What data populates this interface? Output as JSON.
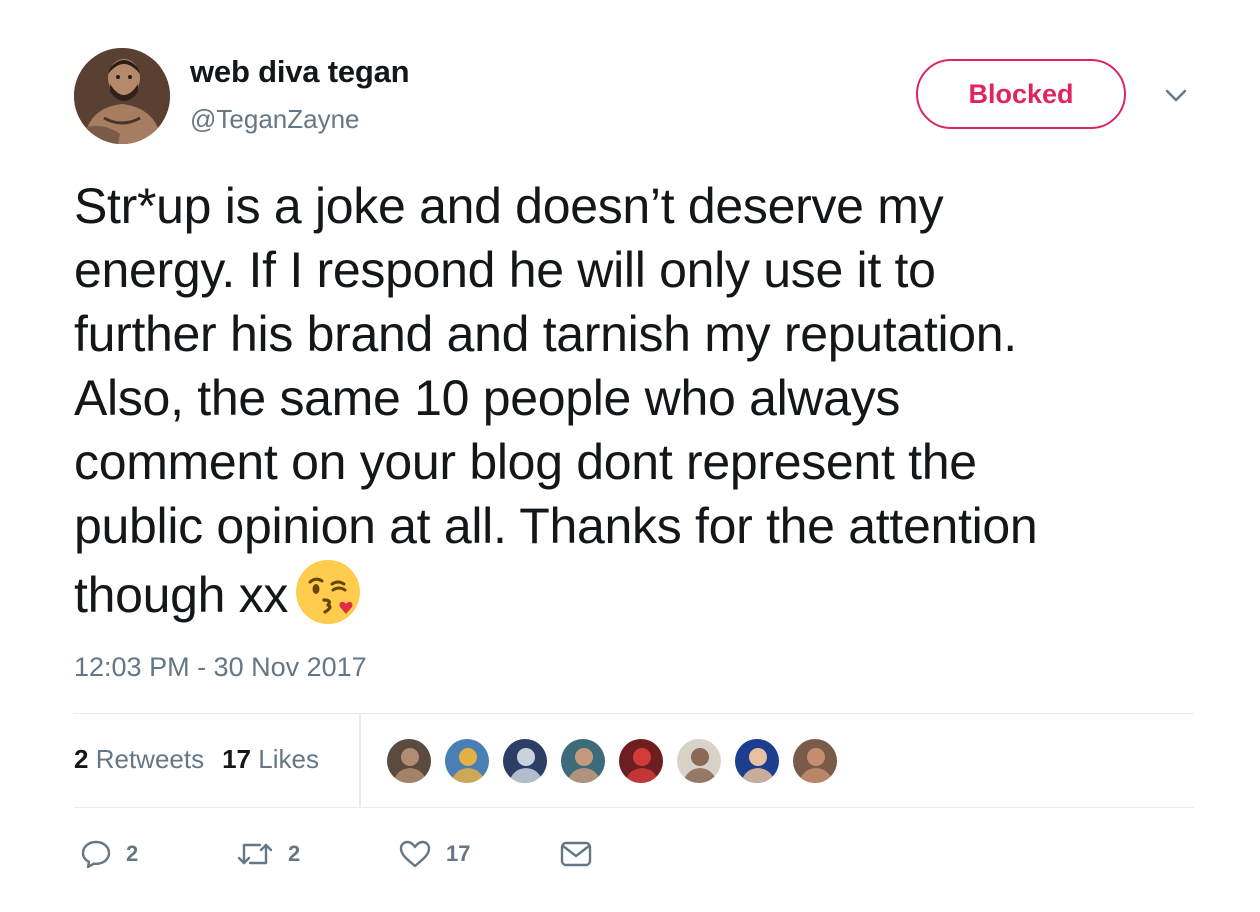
{
  "author": {
    "display_name": "web diva tegan",
    "handle": "@TeganZayne",
    "avatar_icon": "profile-photo"
  },
  "follow_button": {
    "label": "Blocked",
    "color": "#e0245e"
  },
  "menu": {
    "icon": "chevron-down-icon"
  },
  "tweet": {
    "lines": [
      "Str*up is a joke and doesn’t deserve my",
      "energy. If I respond he will only use it to",
      "further his brand and tarnish my reputation.",
      "Also, the same 10 people who always",
      "comment on your blog dont represent the",
      "public opinion at all. Thanks for the attention",
      "though xx"
    ],
    "emoji": "face-throwing-a-kiss",
    "timestamp": "12:03 PM - 30 Nov 2017"
  },
  "stats": {
    "retweets_count": "2",
    "retweets_label": "Retweets",
    "likes_count": "17",
    "likes_label": "Likes"
  },
  "likers": [
    {
      "color": "#5b4a3e",
      "accent": "#b08c70"
    },
    {
      "color": "#4a7fb5",
      "accent": "#e2b045"
    },
    {
      "color": "#2c3e66",
      "accent": "#c9d2df"
    },
    {
      "color": "#3d6b7a",
      "accent": "#c39a7e"
    },
    {
      "color": "#6e1e1e",
      "accent": "#d33b3b"
    },
    {
      "color": "#d8d2c8",
      "accent": "#8a6a55"
    },
    {
      "color": "#1d3d8f",
      "accent": "#e9c0a0"
    },
    {
      "color": "#7a5a48",
      "accent": "#c48e6e"
    }
  ],
  "actions": {
    "reply_count": "2",
    "retweet_count": "2",
    "like_count": "17",
    "accent_color": "#657786"
  }
}
